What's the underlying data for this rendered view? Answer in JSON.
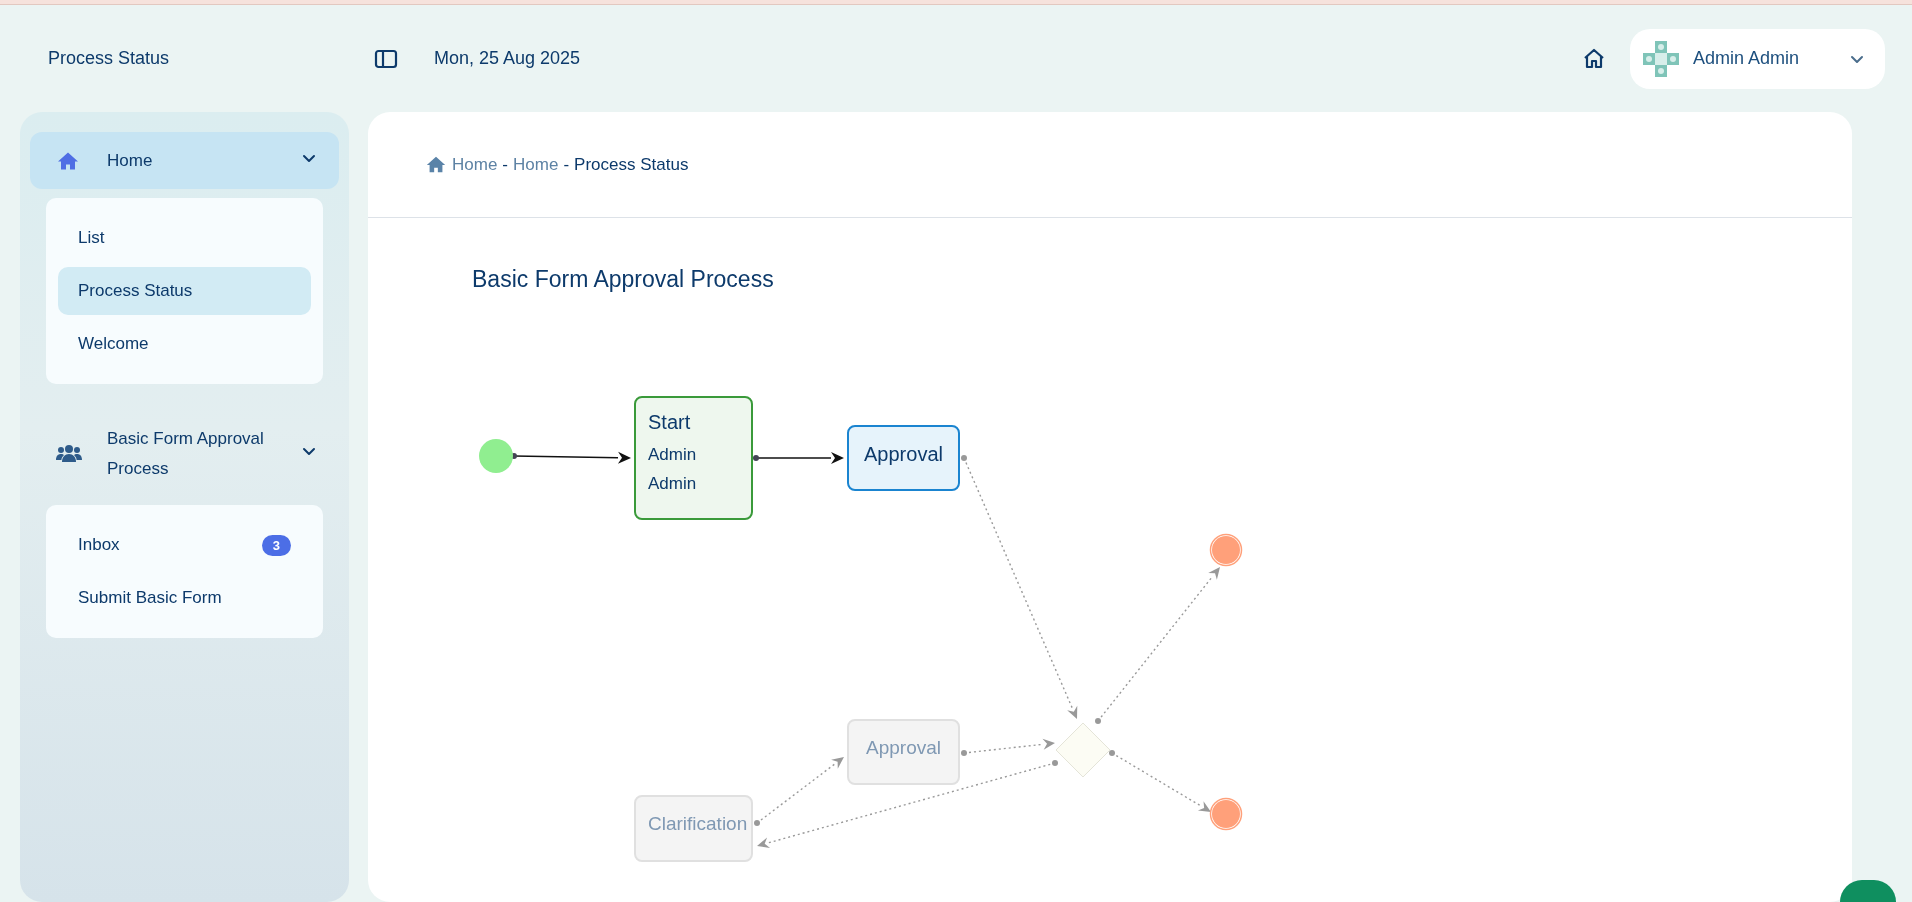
{
  "header": {
    "title": "Process Status",
    "date": "Mon, 25 Aug 2025",
    "user": {
      "name": "Admin Admin"
    }
  },
  "sidebar": {
    "groups": [
      {
        "label": "Home",
        "selected": true,
        "expanded": true,
        "items": [
          {
            "label": "List",
            "selected": false
          },
          {
            "label": "Process Status",
            "selected": true
          },
          {
            "label": "Welcome",
            "selected": false
          }
        ]
      },
      {
        "label": "Basic Form Approval Process",
        "selected": false,
        "expanded": true,
        "items": [
          {
            "label": "Inbox",
            "selected": false,
            "badge": "3"
          },
          {
            "label": "Submit Basic Form",
            "selected": false
          }
        ]
      }
    ]
  },
  "breadcrumb": {
    "items": [
      {
        "label": "Home",
        "current": false
      },
      {
        "label": "Home",
        "current": false
      },
      {
        "label": "Process Status",
        "current": true
      }
    ],
    "separators": [
      "-",
      "-"
    ]
  },
  "diagram": {
    "title": "Basic Form Approval Process",
    "nodes": [
      {
        "kind": "start",
        "done": true
      },
      {
        "kind": "task",
        "label": "Start",
        "assignee": "Admin Admin",
        "done": true,
        "current": false
      },
      {
        "kind": "task",
        "label": "Approval",
        "done": false,
        "current": true
      },
      {
        "kind": "gateway"
      },
      {
        "kind": "end"
      },
      {
        "kind": "end"
      },
      {
        "kind": "task",
        "label": "Approval",
        "done": false,
        "current": false
      },
      {
        "kind": "task",
        "label": "Clarification",
        "done": false,
        "current": false
      }
    ],
    "edges": [
      {
        "taken": true
      },
      {
        "taken": true
      },
      {
        "taken": false
      },
      {
        "taken": false
      },
      {
        "taken": false
      },
      {
        "taken": false
      },
      {
        "taken": false
      },
      {
        "taken": false
      }
    ]
  }
}
